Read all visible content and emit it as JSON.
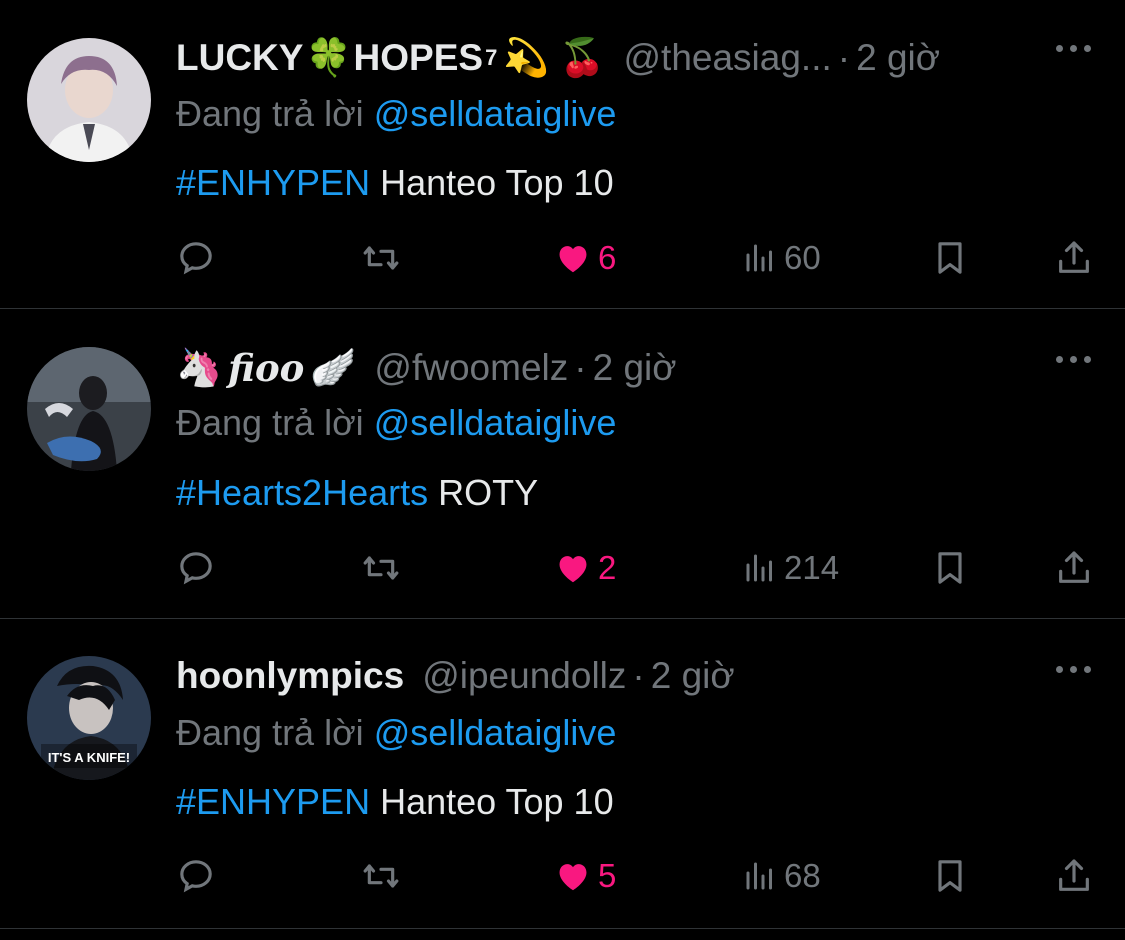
{
  "tweets": [
    {
      "display_name_1": "LUCKY",
      "emoji_1": "🍀",
      "display_name_2": "HOPES",
      "superscript": "7",
      "emoji_2": "💫",
      "emoji_3": "🍒",
      "handle": "@theasiag...",
      "separator": "·",
      "time": "2 giờ",
      "reply_prefix": "Đang trả lời",
      "reply_to": "@selldataiglive",
      "hashtag": "#ENHYPEN",
      "text": " Hanteo Top 10",
      "likes": "6",
      "views": "60",
      "avatar_icon": "avatar-person-icon"
    },
    {
      "emoji_1": "🦄",
      "display_name_1": "fioo",
      "emoji_2": "🪽",
      "handle": "@fwoomelz",
      "separator": "·",
      "time": "2 giờ",
      "reply_prefix": "Đang trả lời",
      "reply_to": "@selldataiglive",
      "hashtag": "#Hearts2Hearts",
      "text": " ROTY",
      "likes": "2",
      "views": "214",
      "avatar_icon": "avatar-photo-icon"
    },
    {
      "display_name_1": "hoonlympics",
      "handle": "@ipeundollz",
      "separator": "·",
      "time": "2 giờ",
      "reply_prefix": "Đang trả lời",
      "reply_to": "@selldataiglive",
      "hashtag": "#ENHYPEN",
      "text": " Hanteo Top 10",
      "likes": "5",
      "views": "68",
      "avatar_caption": "IT'S A KNIFE!",
      "avatar_icon": "avatar-meme-icon"
    }
  ],
  "colors": {
    "background": "#000000",
    "text": "#e7e9ea",
    "muted": "#71767b",
    "link": "#1d9bf0",
    "like": "#f91880",
    "divider": "#2f3336"
  },
  "icons": [
    "reply-icon",
    "retweet-icon",
    "like-icon",
    "views-icon",
    "bookmark-icon",
    "share-icon",
    "more-icon"
  ]
}
